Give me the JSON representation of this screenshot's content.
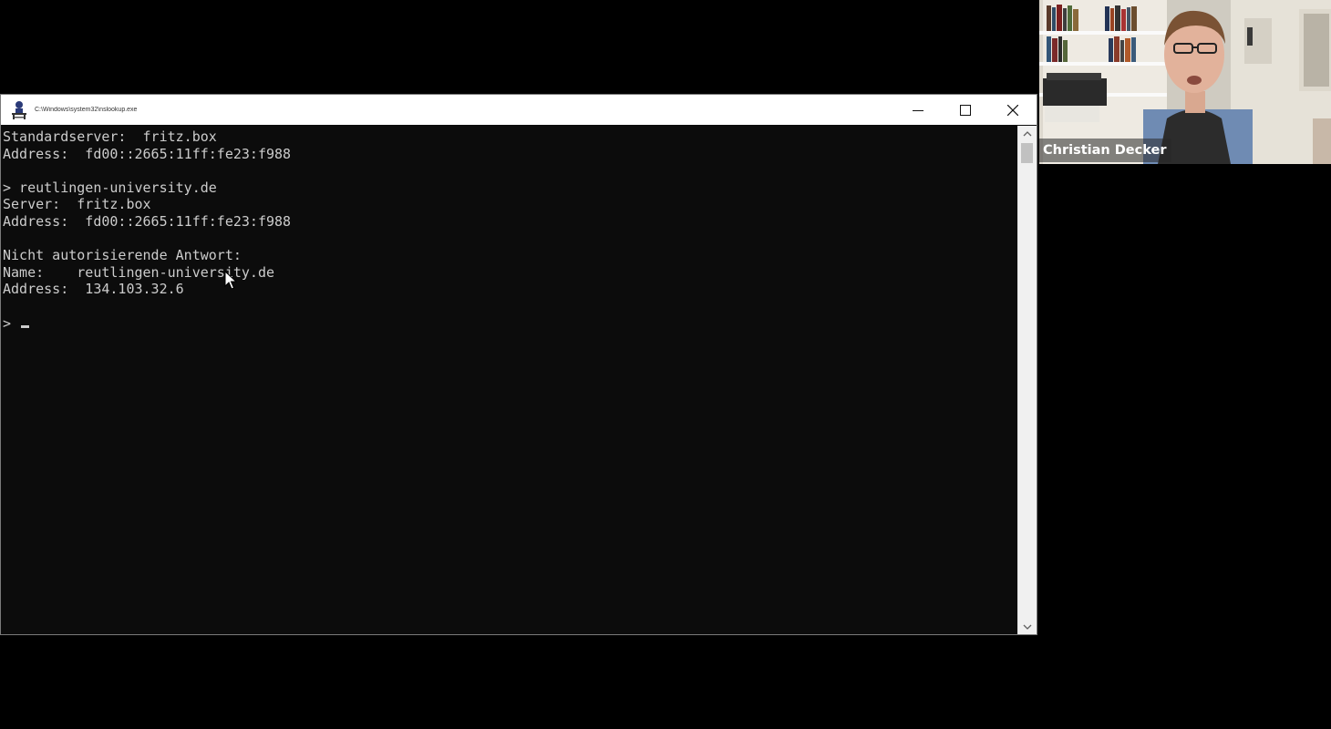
{
  "window": {
    "title": "C:\\Windows\\system32\\nslookup.exe",
    "icon": "nslookup-app-icon",
    "controls": {
      "minimize": "minimize-icon",
      "maximize": "maximize-icon",
      "close": "close-icon"
    }
  },
  "console": {
    "lines": [
      "Standardserver:  fritz.box",
      "Address:  fd00::2665:11ff:fe23:f988",
      "",
      "> reutlingen-university.de",
      "Server:  fritz.box",
      "Address:  fd00::2665:11ff:fe23:f988",
      "",
      "Nicht autorisierende Antwort:",
      "Name:    reutlingen-university.de",
      "Address:  134.103.32.6",
      "",
      ">"
    ],
    "text_color": "#cccccc",
    "background": "#0c0c0c"
  },
  "video": {
    "participant_name": "Christian Decker"
  }
}
